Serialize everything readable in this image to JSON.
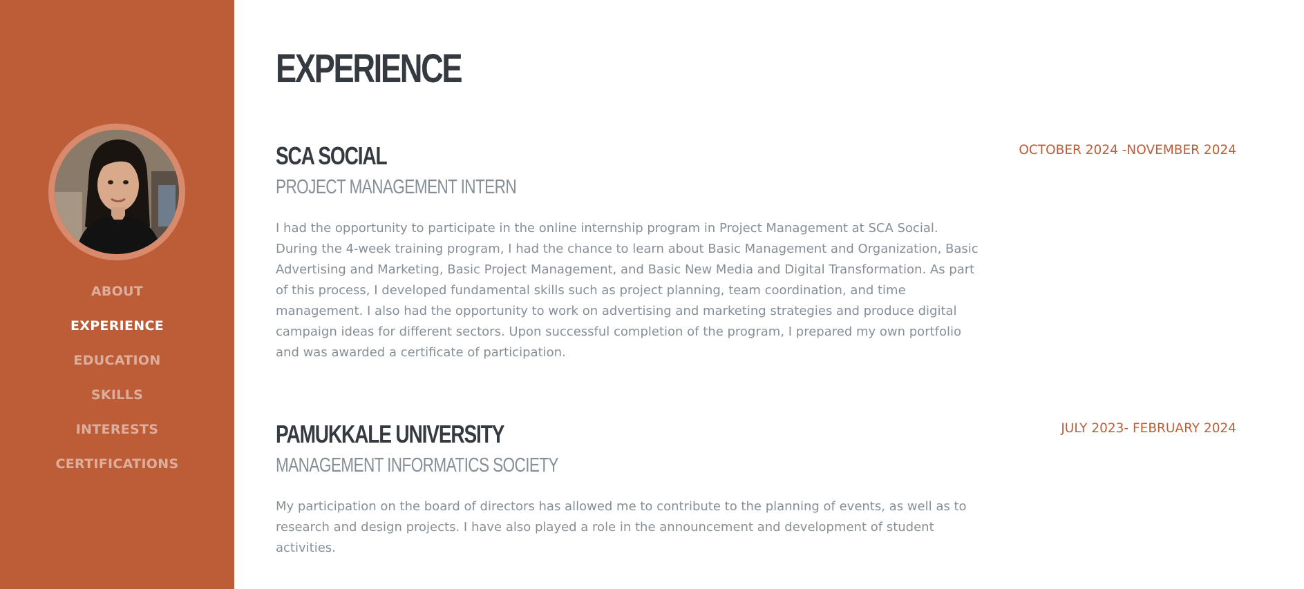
{
  "colors": {
    "sidebar": "#bd5d38",
    "accent": "#bd5d38",
    "heading": "#343a40",
    "muted": "#868e96"
  },
  "sidebar": {
    "avatar_icon": "profile-photo",
    "nav": [
      {
        "label": "ABOUT",
        "active": false
      },
      {
        "label": "EXPERIENCE",
        "active": true
      },
      {
        "label": "EDUCATION",
        "active": false
      },
      {
        "label": "SKILLS",
        "active": false
      },
      {
        "label": "INTERESTS",
        "active": false
      },
      {
        "label": "CERTIFICATIONS",
        "active": false
      }
    ]
  },
  "main": {
    "title": "EXPERIENCE",
    "entries": [
      {
        "organization": "SCA SOCIAL",
        "role": "PROJECT MANAGEMENT INTERN",
        "description": "I had the opportunity to participate in the online internship program in Project Management at SCA Social. During the 4-week training program, I had the chance to learn about Basic Management and Organization, Basic Advertising and Marketing, Basic Project Management, and Basic New Media and Digital Transformation. As part of this process, I developed fundamental skills such as project planning, team coordination, and time management. I also had the opportunity to work on advertising and marketing strategies and produce digital campaign ideas for different sectors. Upon successful completion of the program, I prepared my own portfolio and was awarded a certificate of participation.",
        "date": "OCTOBER 2024 -NOVEMBER 2024"
      },
      {
        "organization": "PAMUKKALE UNIVERSITY",
        "role": "MANAGEMENT INFORMATICS SOCIETY",
        "description": "My participation on the board of directors has allowed me to contribute to the planning of events, as well as to research and design projects. I have also played a role in the announcement and development of student activities.",
        "date": "JULY 2023- FEBRUARY 2024"
      }
    ]
  }
}
